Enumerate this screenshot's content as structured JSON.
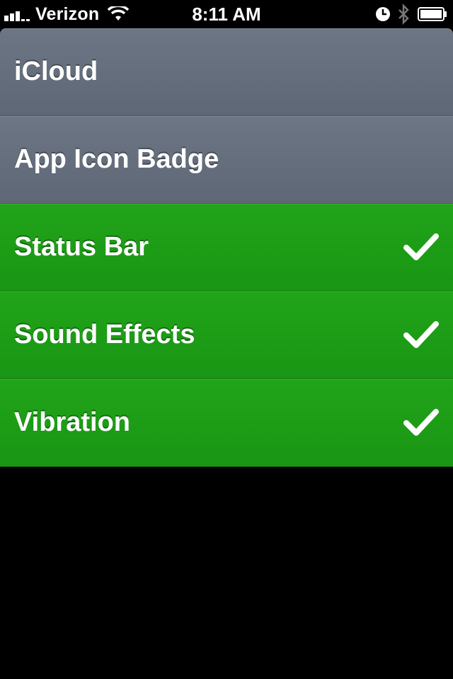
{
  "status_bar": {
    "carrier": "Verizon",
    "time": "8:11 AM",
    "signal_bars": 3,
    "icons": [
      "signal-icon",
      "wifi-icon",
      "clock-icon",
      "bluetooth-icon",
      "battery-icon"
    ]
  },
  "list": {
    "items": [
      {
        "label": "iCloud",
        "enabled": false
      },
      {
        "label": "App Icon Badge",
        "enabled": false
      },
      {
        "label": "Status Bar",
        "enabled": true
      },
      {
        "label": "Sound Effects",
        "enabled": true
      },
      {
        "label": "Vibration",
        "enabled": true
      }
    ]
  },
  "colors": {
    "enabled_row": "#1e9f17",
    "disabled_row": "#656e7c",
    "background": "#000000",
    "text": "#ffffff"
  }
}
